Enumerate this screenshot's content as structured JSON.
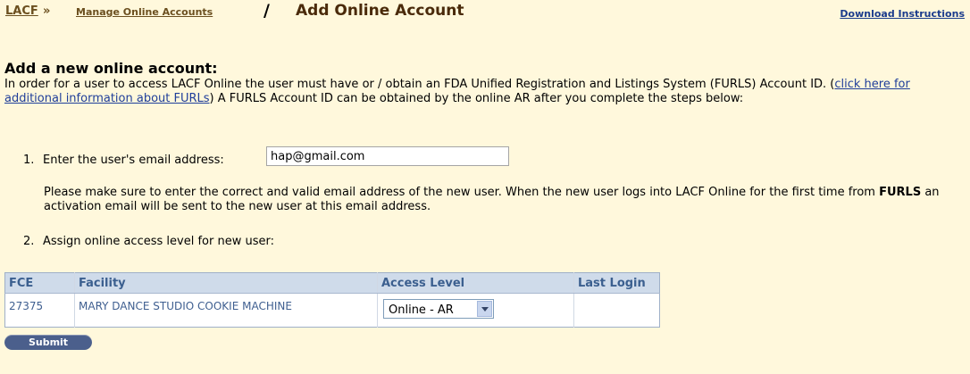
{
  "breadcrumb": {
    "root": "LACF",
    "separator": "»",
    "manage": "Manage Online Accounts",
    "slash": "/",
    "current": "Add Online Account"
  },
  "download_instructions": "Download Instructions",
  "heading": "Add a new online account:",
  "intro": {
    "text_before": "In order for a user to access LACF Online the user must have or / obtain an FDA Unified Registration and Listings System (FURLS) Account ID. (",
    "link": "click here for additional information about FURLs",
    "text_after": ") A FURLS Account ID can be obtained by the online AR after you complete the steps below:"
  },
  "step1": {
    "number": "1.",
    "label": "Enter the user's email address:",
    "email_value": "hap@gmail.com"
  },
  "note": {
    "text_before": "Please make sure to enter the correct and valid email address of the new user. When the new user logs into LACF Online for the first time from ",
    "bold": "FURLS",
    "text_after": " an activation email will be sent to the new user at this email address."
  },
  "step2": {
    "number": "2.",
    "label": "Assign online access level for new user:"
  },
  "table": {
    "headers": {
      "fce": "FCE",
      "facility": "Facility",
      "access_level": "Access Level",
      "last_login": "Last Login"
    },
    "rows": [
      {
        "fce": "27375",
        "facility": "MARY DANCE STUDIO COOKIE MACHINE",
        "access_level": "Online - AR",
        "last_login": ""
      }
    ]
  },
  "submit_label": "Submit",
  "colors": {
    "background": "#fff8dc",
    "table_header_bg": "#cfdbea",
    "table_header_text": "#3b5f8f",
    "link": "#1f3e9a",
    "submit_bg": "#4b5f8c"
  }
}
